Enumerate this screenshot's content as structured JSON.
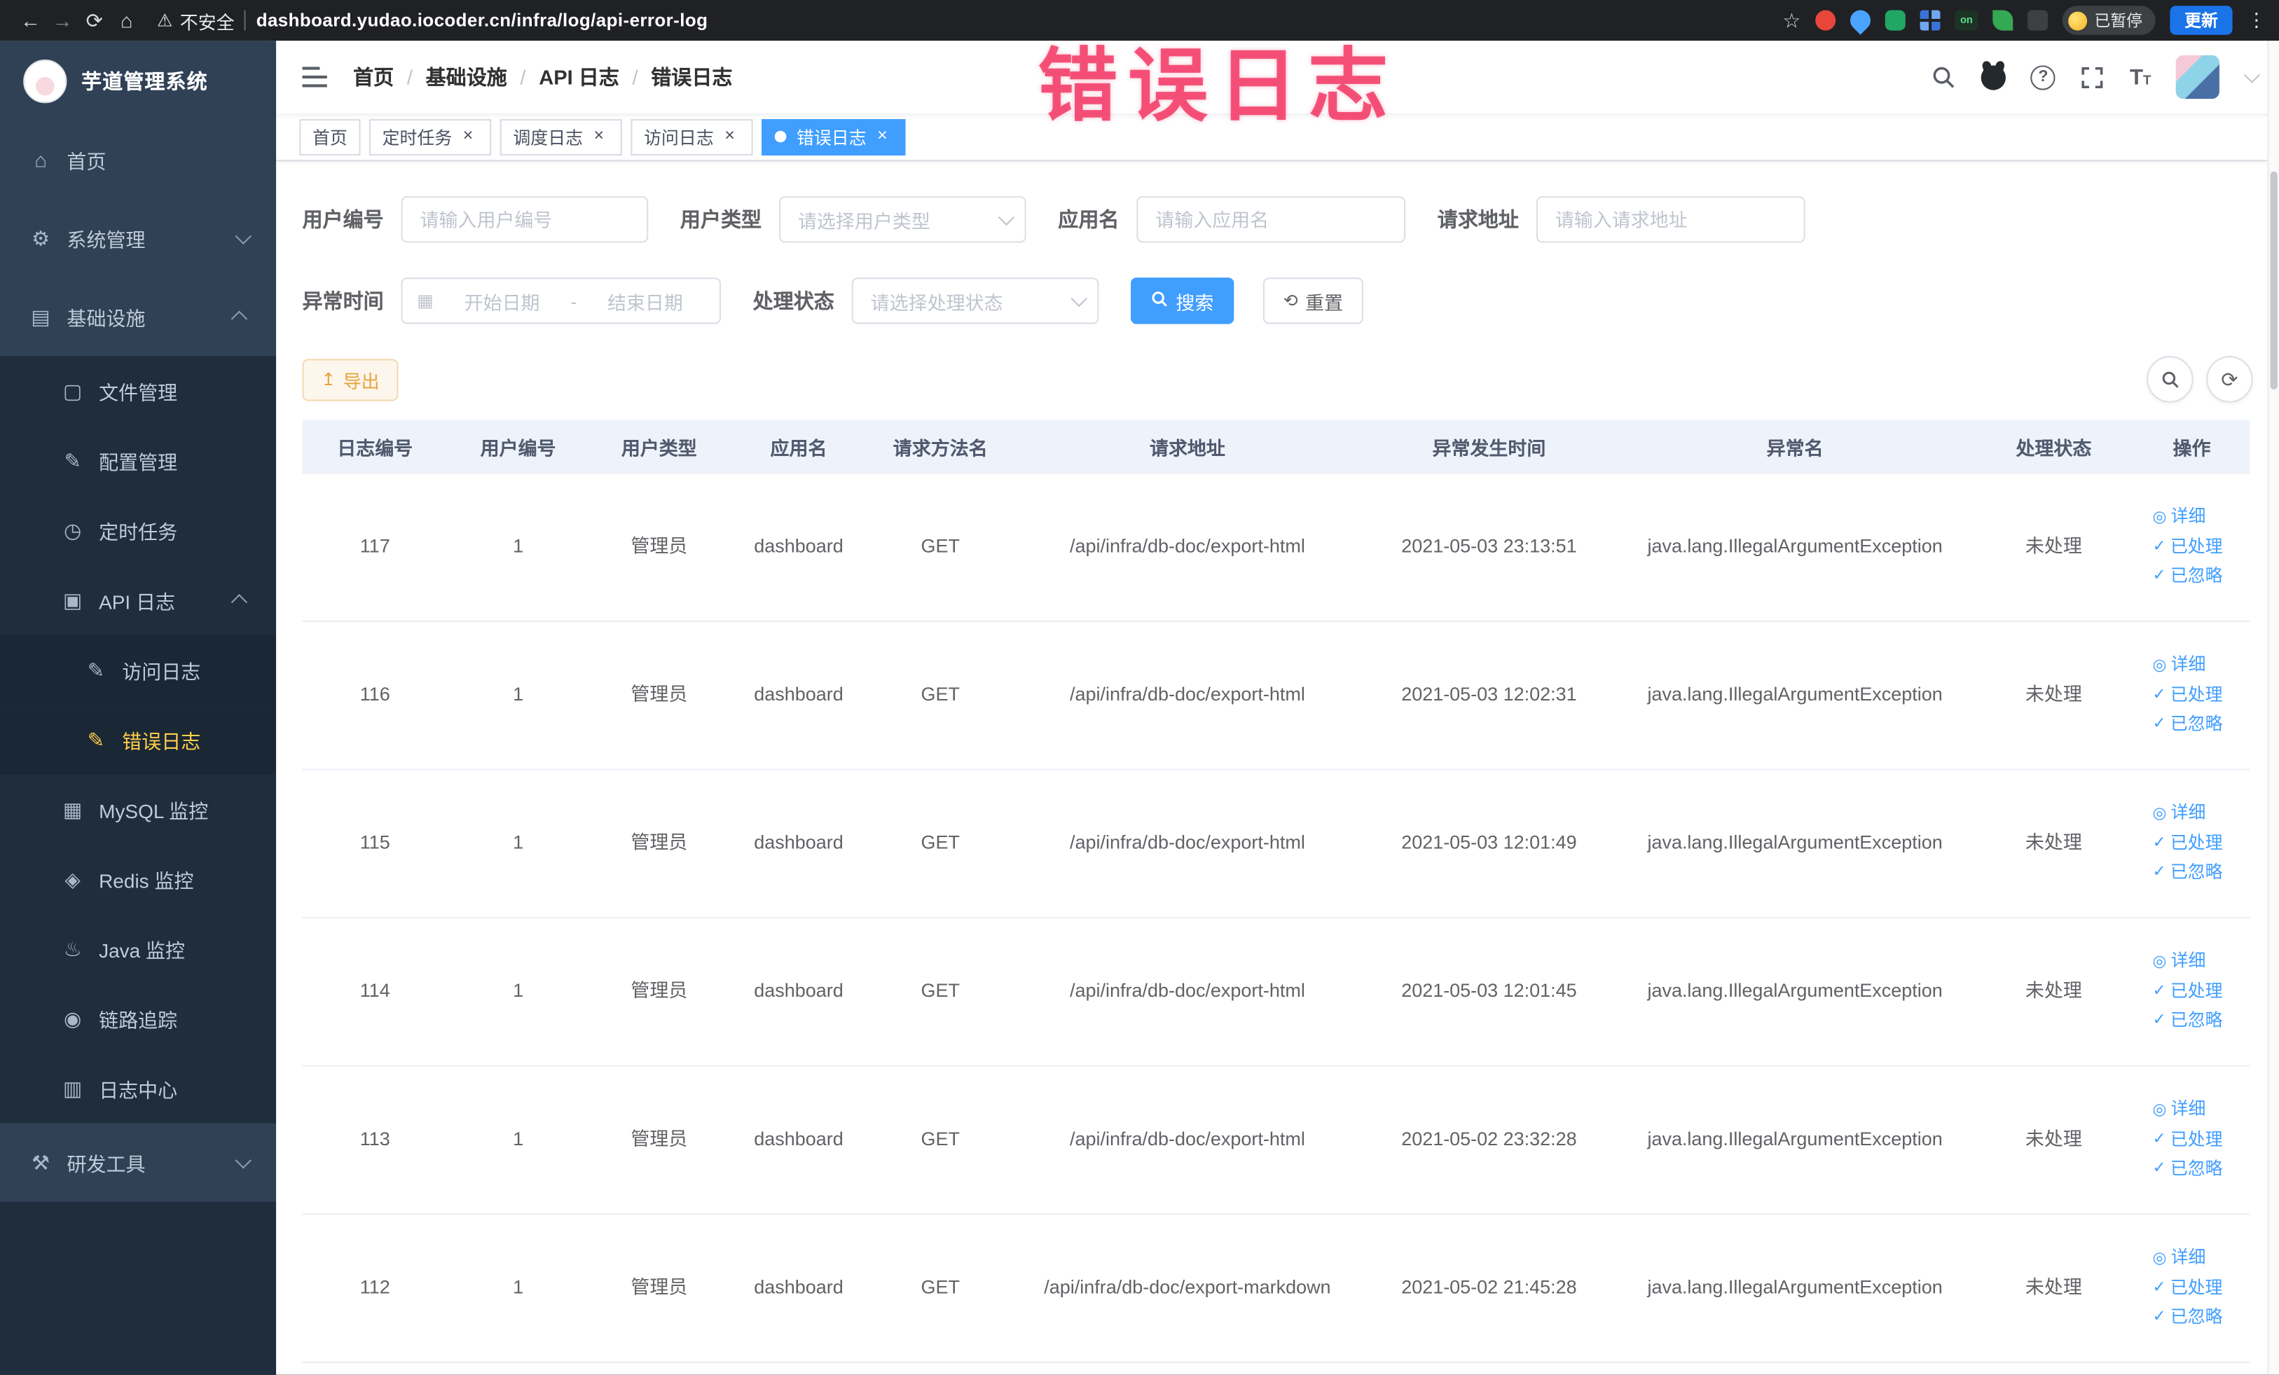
{
  "theme": {
    "accent": "#409eff",
    "sidebar_bg": "#304156",
    "sidebar_sub_bg": "#1f2d3d",
    "active_menu_text": "#ffd04b",
    "warning": "#e6a23c",
    "annotation_color": "#f33e6a"
  },
  "annotation": {
    "text": "错误日志"
  },
  "browser": {
    "nav_icons": {
      "back": "←",
      "forward": "→",
      "reload": "⟳",
      "home": "⌂"
    },
    "security": {
      "icon": "⚠",
      "label": "不安全"
    },
    "url": "dashboard.yudao.iocoder.cn/infra/log/api-error-log",
    "star_icon": "☆",
    "extension_on_label": "on",
    "paused_badge": "已暂停",
    "update_button": "更新",
    "menu_icon": "⋮"
  },
  "sidebar": {
    "logo_title": "芋道管理系统",
    "items": [
      {
        "label": "首页",
        "icon_name": "home-icon",
        "icon": "⌂",
        "level": 1
      },
      {
        "label": "系统管理",
        "icon_name": "gear-icon",
        "icon": "⚙",
        "level": 1,
        "chevron": "down"
      },
      {
        "label": "基础设施",
        "icon_name": "infrastructure-icon",
        "icon": "▤",
        "level": 1,
        "chevron": "up"
      },
      {
        "label": "文件管理",
        "icon_name": "file-manage-icon",
        "icon": "▢",
        "level": 2
      },
      {
        "label": "配置管理",
        "icon_name": "config-manage-icon",
        "icon": "✎",
        "level": 2
      },
      {
        "label": "定时任务",
        "icon_name": "timer-icon",
        "icon": "◷",
        "level": 2
      },
      {
        "label": "API 日志",
        "icon_name": "api-log-icon",
        "icon": "▣",
        "level": 2,
        "chevron": "up"
      },
      {
        "label": "访问日志",
        "icon_name": "access-log-icon",
        "icon": "✎",
        "level": 3
      },
      {
        "label": "错误日志",
        "icon_name": "error-log-icon",
        "icon": "✎",
        "level": 3,
        "active": true
      },
      {
        "label": "MySQL 监控",
        "icon_name": "mysql-monitor-icon",
        "icon": "▦",
        "level": 2
      },
      {
        "label": "Redis 监控",
        "icon_name": "redis-monitor-icon",
        "icon": "◈",
        "level": 2
      },
      {
        "label": "Java 监控",
        "icon_name": "java-monitor-icon",
        "icon": "♨",
        "level": 2
      },
      {
        "label": "链路追踪",
        "icon_name": "trace-icon",
        "icon": "◉",
        "level": 2
      },
      {
        "label": "日志中心",
        "icon_name": "log-center-icon",
        "icon": "▥",
        "level": 2
      },
      {
        "label": "研发工具",
        "icon_name": "dev-tools-icon",
        "icon": "⚒",
        "level": 1,
        "chevron": "down"
      }
    ]
  },
  "navbar": {
    "breadcrumb": [
      {
        "label": "首页"
      },
      {
        "label": "基础设施"
      },
      {
        "label": "API 日志"
      },
      {
        "label": "错误日志"
      }
    ],
    "help_icon": "?",
    "font_icon": {
      "large": "T",
      "small": "T"
    }
  },
  "tabs": [
    {
      "label": "首页"
    },
    {
      "label": "定时任务",
      "close": "×"
    },
    {
      "label": "调度日志",
      "close": "×"
    },
    {
      "label": "访问日志",
      "close": "×"
    },
    {
      "label": "错误日志",
      "close": "×",
      "active": true
    }
  ],
  "filters": {
    "user_id": {
      "label": "用户编号",
      "placeholder": "请输入用户编号"
    },
    "user_type": {
      "label": "用户类型",
      "placeholder": "请选择用户类型"
    },
    "app_name": {
      "label": "应用名",
      "placeholder": "请输入应用名"
    },
    "request_url": {
      "label": "请求地址",
      "placeholder": "请输入请求地址"
    },
    "exception_time": {
      "label": "异常时间",
      "calendar_icon": "▦",
      "start_placeholder": "开始日期",
      "separator": "-",
      "end_placeholder": "结束日期"
    },
    "process_status": {
      "label": "处理状态",
      "placeholder": "请选择处理状态"
    },
    "search_button": "搜索",
    "reset_button": "重置",
    "reset_icon": "⟲"
  },
  "toolbar": {
    "export_button": "导出",
    "export_icon": "↥",
    "refresh_icon": "⟳"
  },
  "table": {
    "columns": [
      "日志编号",
      "用户编号",
      "用户类型",
      "应用名",
      "请求方法名",
      "请求地址",
      "异常发生时间",
      "异常名",
      "处理状态",
      "操作"
    ],
    "row_actions": [
      {
        "icon": "◎",
        "label": "详细"
      },
      {
        "icon": "✓",
        "label": "已处理"
      },
      {
        "icon": "✓",
        "label": "已忽略"
      }
    ],
    "rows": [
      {
        "id": "117",
        "user_id": "1",
        "user_type": "管理员",
        "app_name": "dashboard",
        "method": "GET",
        "url": "/api/infra/db-doc/export-html",
        "time": "2021-05-03 23:13:51",
        "exception": "java.lang.IllegalArgumentException",
        "status": "未处理"
      },
      {
        "id": "116",
        "user_id": "1",
        "user_type": "管理员",
        "app_name": "dashboard",
        "method": "GET",
        "url": "/api/infra/db-doc/export-html",
        "time": "2021-05-03 12:02:31",
        "exception": "java.lang.IllegalArgumentException",
        "status": "未处理"
      },
      {
        "id": "115",
        "user_id": "1",
        "user_type": "管理员",
        "app_name": "dashboard",
        "method": "GET",
        "url": "/api/infra/db-doc/export-html",
        "time": "2021-05-03 12:01:49",
        "exception": "java.lang.IllegalArgumentException",
        "status": "未处理"
      },
      {
        "id": "114",
        "user_id": "1",
        "user_type": "管理员",
        "app_name": "dashboard",
        "method": "GET",
        "url": "/api/infra/db-doc/export-html",
        "time": "2021-05-03 12:01:45",
        "exception": "java.lang.IllegalArgumentException",
        "status": "未处理"
      },
      {
        "id": "113",
        "user_id": "1",
        "user_type": "管理员",
        "app_name": "dashboard",
        "method": "GET",
        "url": "/api/infra/db-doc/export-html",
        "time": "2021-05-02 23:32:28",
        "exception": "java.lang.IllegalArgumentException",
        "status": "未处理"
      },
      {
        "id": "112",
        "user_id": "1",
        "user_type": "管理员",
        "app_name": "dashboard",
        "method": "GET",
        "url": "/api/infra/db-doc/export-markdown",
        "time": "2021-05-02 21:45:28",
        "exception": "java.lang.IllegalArgumentException",
        "status": "未处理"
      }
    ]
  }
}
